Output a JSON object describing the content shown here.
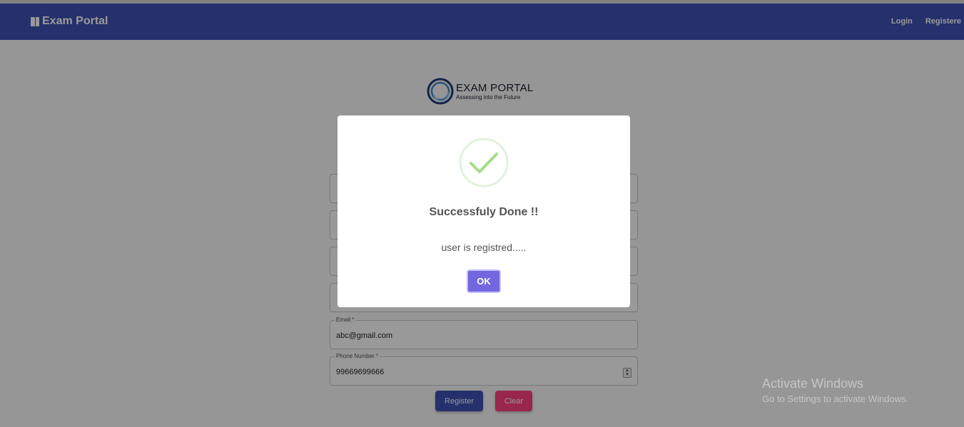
{
  "navbar": {
    "brand": "Exam Portal",
    "brand_icon": "book-icon",
    "links": [
      "Login",
      "Registere"
    ],
    "color": "#3f51b5"
  },
  "logo": {
    "title": "EXAM PORTAL",
    "tagline": "Assessing into the Future"
  },
  "form": {
    "email": {
      "label": "Email *",
      "value": "abc@gmail.com"
    },
    "phone": {
      "label": "Phone Number *",
      "value": "99669699666"
    },
    "register_label": "Register",
    "clear_label": "Clear"
  },
  "modal": {
    "icon": "success-check-icon",
    "title": "Successfuly Done !!",
    "text": "user is registred.....",
    "ok_label": "OK",
    "ok_color": "#7367e0"
  },
  "watermark": {
    "title": "Activate Windows",
    "subtitle": "Go to Settings to activate Windows."
  }
}
